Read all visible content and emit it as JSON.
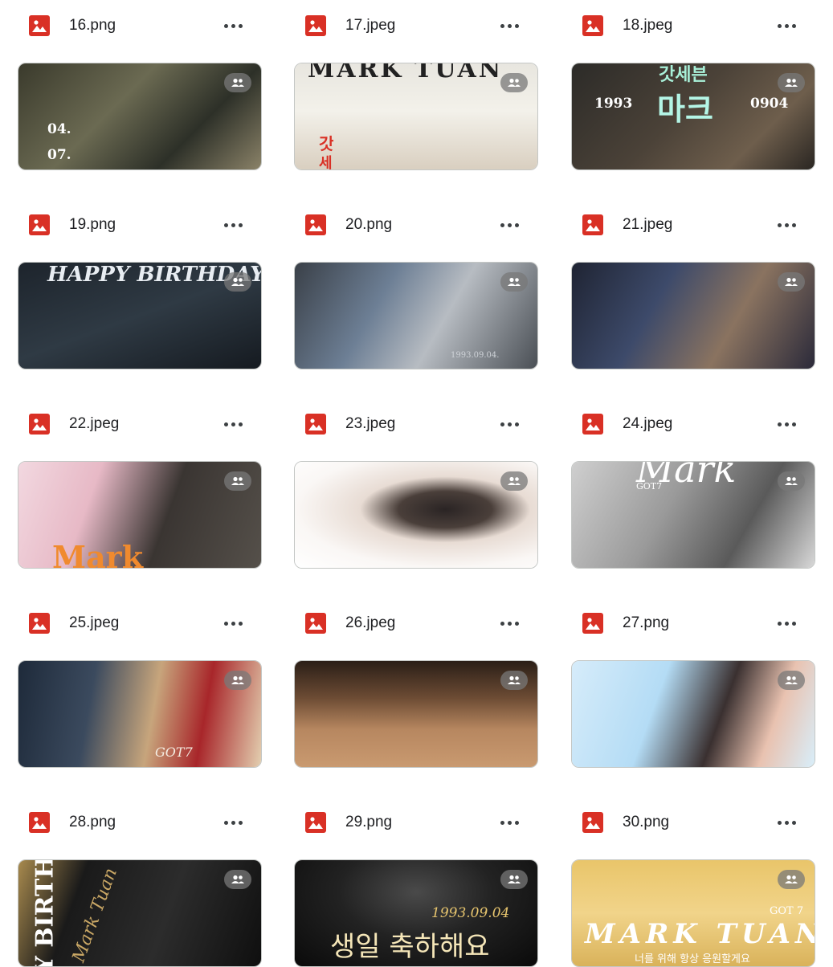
{
  "files": [
    {
      "name": "16.png",
      "thumb_text": [
        "04.",
        "07."
      ]
    },
    {
      "name": "17.jpeg",
      "thumb_text": [
        "MARK TUAN",
        "갓",
        "세"
      ]
    },
    {
      "name": "18.jpeg",
      "thumb_text": [
        "갓세븐",
        "1993",
        "마크",
        "0904"
      ]
    },
    {
      "name": "19.png",
      "thumb_text": [
        "HAPPY BIRTHDAY!"
      ]
    },
    {
      "name": "20.png",
      "thumb_text": [
        "1993.09.04."
      ]
    },
    {
      "name": "21.jpeg",
      "thumb_text": []
    },
    {
      "name": "22.jpeg",
      "thumb_text": [
        "Mark"
      ]
    },
    {
      "name": "23.jpeg",
      "thumb_text": []
    },
    {
      "name": "24.jpeg",
      "thumb_text": [
        "Mark",
        "GOT7"
      ]
    },
    {
      "name": "25.jpeg",
      "thumb_text": [
        "GOT7"
      ]
    },
    {
      "name": "26.jpeg",
      "thumb_text": []
    },
    {
      "name": "27.png",
      "thumb_text": []
    },
    {
      "name": "28.png",
      "thumb_text": [
        "Y BIRTH",
        "Mark Tuan"
      ]
    },
    {
      "name": "29.png",
      "thumb_text": [
        "1993.09.04",
        "생일 축하해요"
      ]
    },
    {
      "name": "30.png",
      "thumb_text": [
        "MARK TUAN",
        "GOT 7",
        "너를 위해 항상 응원할게요"
      ]
    }
  ],
  "icons": {
    "file_type": "image-file-icon",
    "more": "more-options-icon",
    "shared": "shared-people-icon"
  },
  "colors": {
    "file_icon": "#d93025",
    "badge": "#7a7a7a",
    "border": "#c4c7c5"
  }
}
